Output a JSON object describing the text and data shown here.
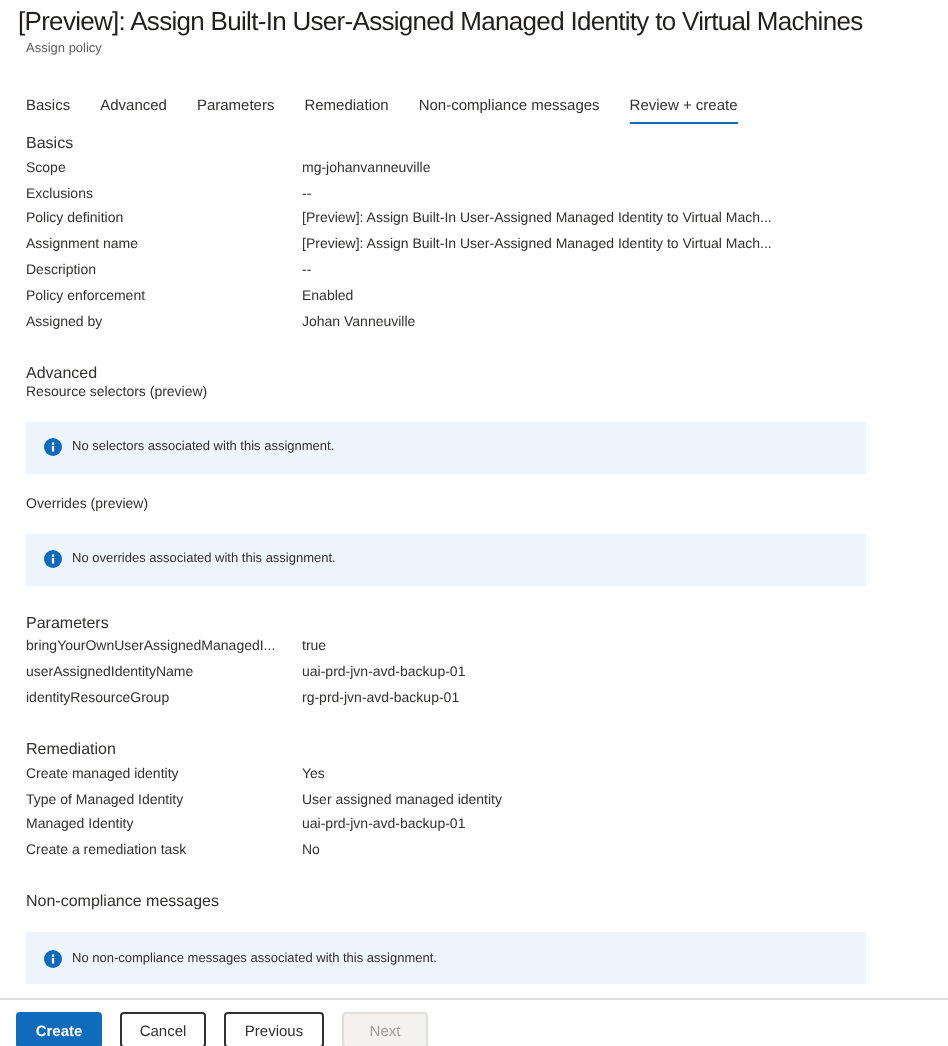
{
  "title": "[Preview]: Assign Built-In User-Assigned Managed Identity to Virtual Machines",
  "subtitle": "Assign policy",
  "tabs": [
    {
      "label": "Basics",
      "selected": false
    },
    {
      "label": "Advanced",
      "selected": false
    },
    {
      "label": "Parameters",
      "selected": false
    },
    {
      "label": "Remediation",
      "selected": false
    },
    {
      "label": "Non-compliance messages",
      "selected": false
    },
    {
      "label": "Review + create",
      "selected": true
    }
  ],
  "blocks": [
    {
      "kind": "heading",
      "text": "Basics"
    },
    {
      "kind": "row",
      "label": "Scope",
      "value": "mg-johanvanneuville"
    },
    {
      "kind": "row",
      "label": "Exclusions",
      "value": "--"
    },
    {
      "kind": "row",
      "label": "Policy definition",
      "value": "[Preview]: Assign Built-In User-Assigned Managed Identity to Virtual Mach..."
    },
    {
      "kind": "row",
      "label": "Assignment name",
      "value": "[Preview]: Assign Built-In User-Assigned Managed Identity to Virtual Mach..."
    },
    {
      "kind": "row",
      "label": "Description",
      "value": "--"
    },
    {
      "kind": "row",
      "label": "Policy enforcement",
      "value": "Enabled"
    },
    {
      "kind": "row",
      "label": "Assigned by",
      "value": "Johan Vanneuville"
    },
    {
      "kind": "heading",
      "text": "Advanced"
    },
    {
      "kind": "subheading",
      "text": "Resource selectors (preview)"
    },
    {
      "kind": "info",
      "text": "No selectors associated with this assignment."
    },
    {
      "kind": "subheading",
      "text": "Overrides (preview)"
    },
    {
      "kind": "info",
      "text": "No overrides associated with this assignment."
    },
    {
      "kind": "heading",
      "text": "Parameters"
    },
    {
      "kind": "row",
      "label": "bringYourOwnUserAssignedManagedI...",
      "value": "true"
    },
    {
      "kind": "row",
      "label": "userAssignedIdentityName",
      "value": "uai-prd-jvn-avd-backup-01"
    },
    {
      "kind": "row",
      "label": "identityResourceGroup",
      "value": "rg-prd-jvn-avd-backup-01"
    },
    {
      "kind": "heading",
      "text": "Remediation"
    },
    {
      "kind": "row",
      "label": "Create managed identity",
      "value": "Yes"
    },
    {
      "kind": "row",
      "label": "Type of Managed Identity",
      "value": "User assigned managed identity"
    },
    {
      "kind": "row",
      "label": "Managed Identity",
      "value": "uai-prd-jvn-avd-backup-01"
    },
    {
      "kind": "row",
      "label": "Create a remediation task",
      "value": "No"
    },
    {
      "kind": "heading",
      "text": "Non-compliance messages"
    },
    {
      "kind": "info",
      "text": "No non-compliance messages associated with this assignment."
    }
  ],
  "buttons": [
    {
      "label": "Create",
      "kind": "primary",
      "disabled": false
    },
    {
      "label": "Cancel",
      "kind": "secondary",
      "disabled": false
    },
    {
      "label": "Previous",
      "kind": "secondary",
      "disabled": false
    },
    {
      "label": "Next",
      "kind": "secondary",
      "disabled": true
    }
  ]
}
